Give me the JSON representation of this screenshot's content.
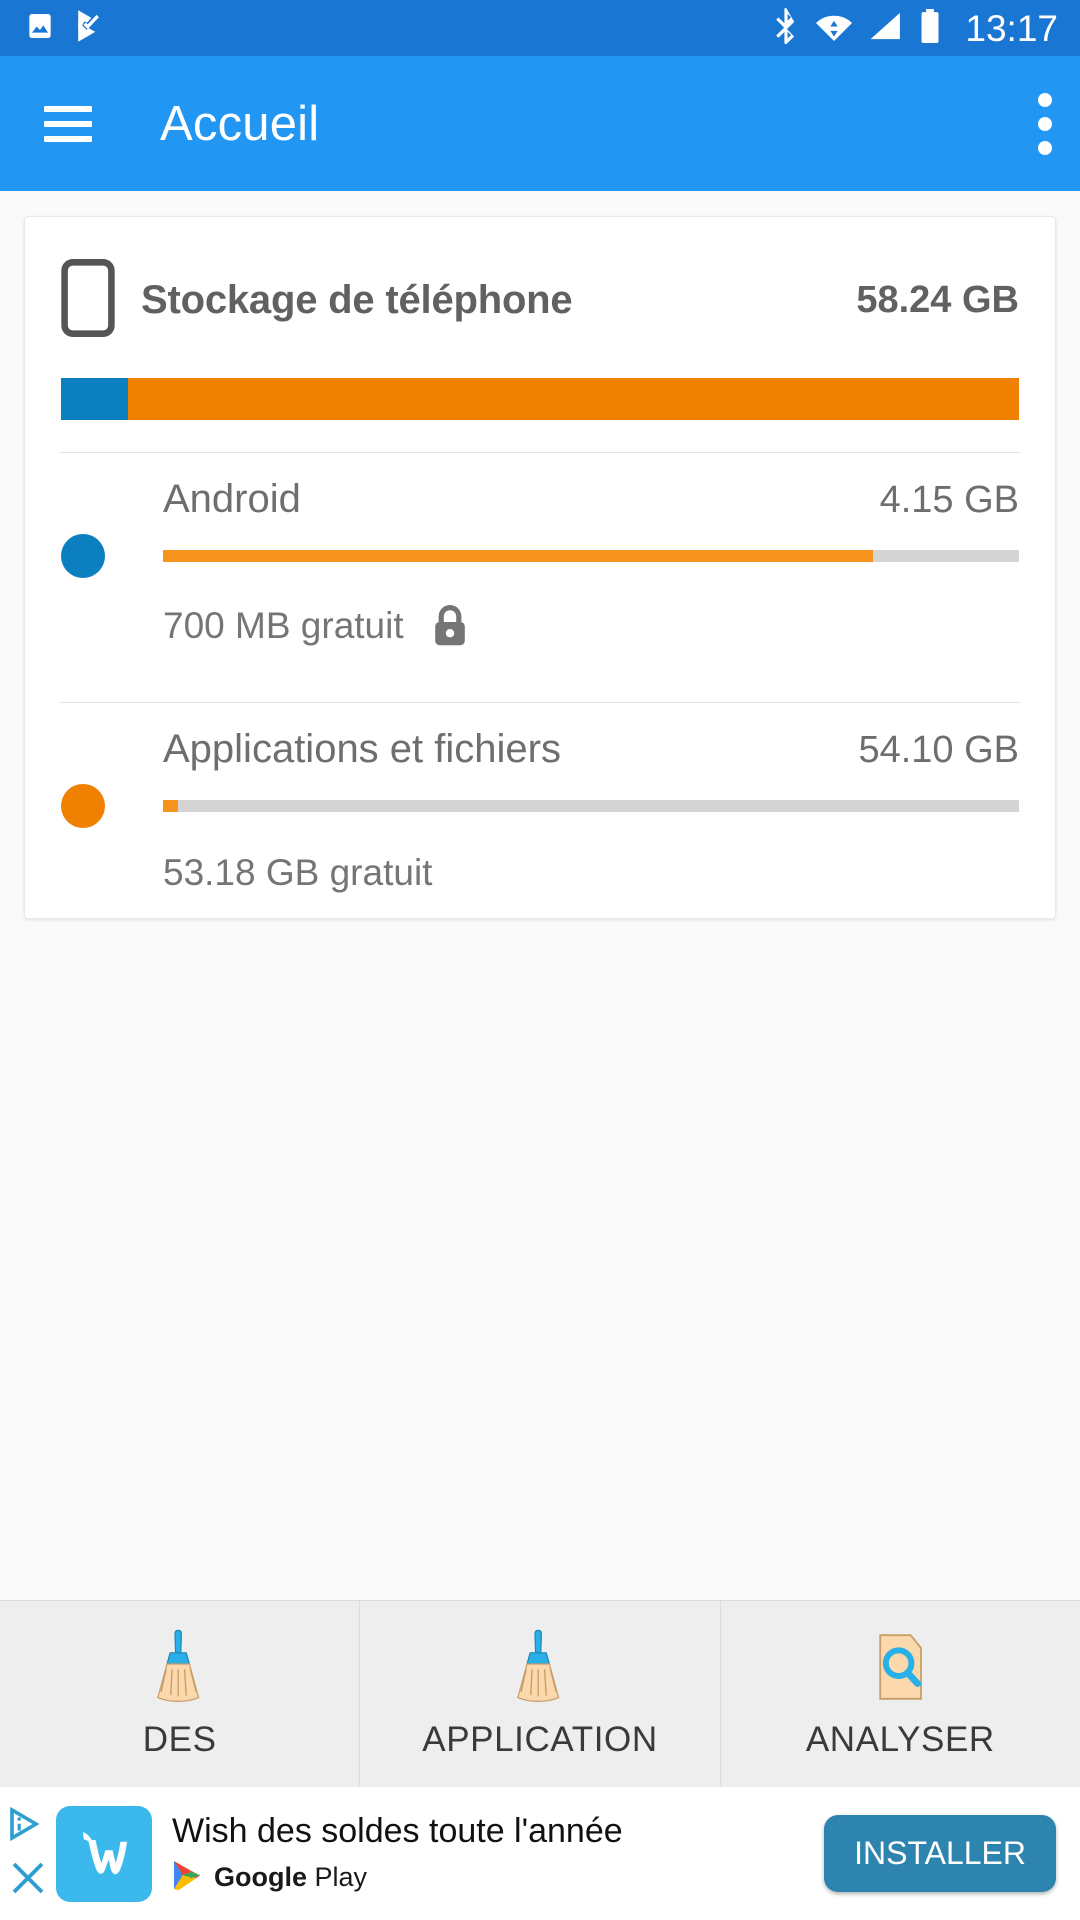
{
  "statusbar": {
    "time": "13:17",
    "left_icons": [
      "image-icon",
      "play-protect-icon"
    ],
    "right_icons": [
      "bluetooth-icon",
      "wifi-icon",
      "cellular-signal-icon",
      "battery-icon"
    ],
    "background": "#1976d2"
  },
  "appbar": {
    "title": "Accueil",
    "menu_icon": "hamburger-menu-icon",
    "overflow_icon": "overflow-menu-icon",
    "background": "#2196f3"
  },
  "storage_card": {
    "icon": "phone-icon",
    "title": "Stockage de téléphone",
    "total": "58.24 GB",
    "total_bar": [
      {
        "name": "Android",
        "color": "#0b7fc0",
        "percent": 7
      },
      {
        "name": "Applications et fichiers",
        "color": "#f08000",
        "percent": 93
      }
    ],
    "rows": [
      {
        "name": "Android",
        "size": "4.15 GB",
        "dot_color": "#0b7fc0",
        "fill_color": "#f7941d",
        "fill_percent": 83,
        "free": "700 MB gratuit",
        "lock_icon": "lock-icon",
        "has_lock": true
      },
      {
        "name": "Applications et fichiers",
        "size": "54.10 GB",
        "dot_color": "#f08000",
        "fill_color": "#f7941d",
        "fill_percent": 1.7,
        "free": "53.18 GB gratuit",
        "lock_icon": "",
        "has_lock": false
      }
    ]
  },
  "tabs": [
    {
      "label": "DES",
      "icon": "broom-icon"
    },
    {
      "label": "APPLICATION",
      "icon": "broom-icon"
    },
    {
      "label": "ANALYSER",
      "icon": "file-search-icon"
    }
  ],
  "ad": {
    "title": "Wish des soldes toute l'année",
    "store": "Google",
    "store_suffix": " Play",
    "app_icon_letter": "w",
    "install_label": "INSTALLER",
    "info_icon": "ad-info-icon",
    "close_icon": "ad-close-icon",
    "accent": "#2d84ae"
  }
}
